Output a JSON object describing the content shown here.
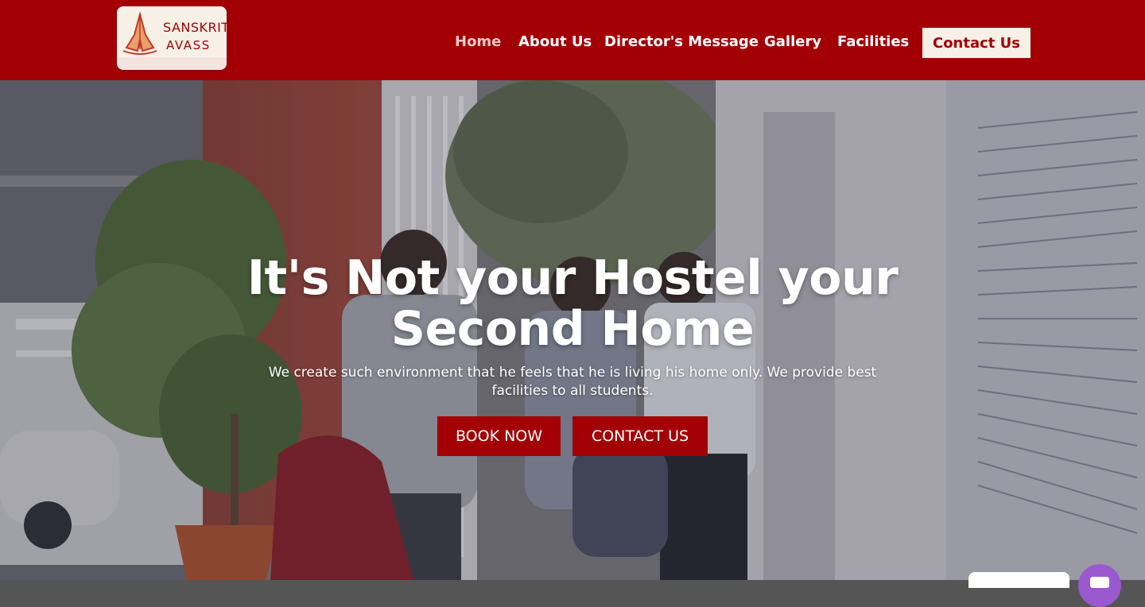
{
  "brand": {
    "line1": "SANSKRITI",
    "line2": "AVASS",
    "accent": "#a30006",
    "logo_bg": "#f6f0e6"
  },
  "nav": {
    "items": [
      {
        "label": "Home",
        "active": true
      },
      {
        "label": "About Us"
      },
      {
        "label": "Director's Message"
      },
      {
        "label": "Gallery"
      },
      {
        "label": "Facilities"
      }
    ],
    "contact_label": "Contact Us"
  },
  "hero": {
    "headline_line1": "It's Not your Hostel your",
    "headline_line2": "Second Home",
    "subtitle": "We create such environment that he feels that he is living his home only. We provide best facilities to all students.",
    "book_label": "BOOK NOW",
    "contact_label": "CONTACT US"
  },
  "widgets": {
    "chat_icon": "chat-icon",
    "chat_color": "#9b59d0"
  }
}
